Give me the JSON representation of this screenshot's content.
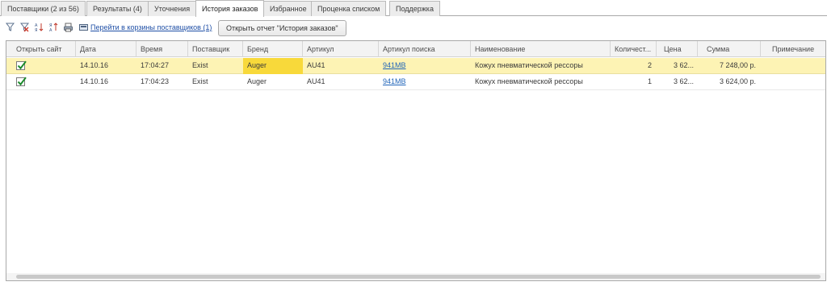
{
  "tabs": [
    {
      "label": "Поставщики (2 из 56)"
    },
    {
      "label": "Результаты (4)"
    },
    {
      "label": "Уточнения"
    },
    {
      "label": "История заказов"
    },
    {
      "label": "Избранное"
    },
    {
      "label": "Проценка  списком"
    },
    {
      "label": "Поддержка"
    }
  ],
  "active_tab": "История заказов",
  "toolbar": {
    "icons": [
      "filter-icon",
      "filter-clear-icon",
      "sort-ascending-icon",
      "sort-descending-icon",
      "print-icon",
      "cart-icon"
    ],
    "cart_link": "Перейти в корзины поставщиков (1)",
    "report_button": "Открыть отчет \"История заказов\""
  },
  "table": {
    "columns": [
      "Открыть сайт",
      "Дата",
      "Время",
      "Поставщик",
      "Бренд",
      "Артикул",
      "Артикул поиска",
      "Наименование",
      "Количест...",
      "Цена",
      "Сумма",
      "Примечание"
    ],
    "rows": [
      {
        "open_site": true,
        "date": "14.10.16",
        "time": "17:04:27",
        "supplier": "Exist",
        "brand": "Auger",
        "article": "AU41",
        "search_article": "941MB",
        "name": "Кожух пневматической рессоры",
        "qty": "2",
        "price": "3 62...",
        "sum": "7 248,00 р.",
        "note": ""
      },
      {
        "open_site": true,
        "date": "14.10.16",
        "time": "17:04:23",
        "supplier": "Exist",
        "brand": "Auger",
        "article": "AU41",
        "search_article": "941MB",
        "name": "Кожух пневматической рессоры",
        "qty": "1",
        "price": "3 62...",
        "sum": "3 624,00 р.",
        "note": ""
      }
    ]
  },
  "colors": {
    "selected_row": "#fdf3b4",
    "brand_highlight": "#f8d93a",
    "link": "#1f64b9"
  }
}
